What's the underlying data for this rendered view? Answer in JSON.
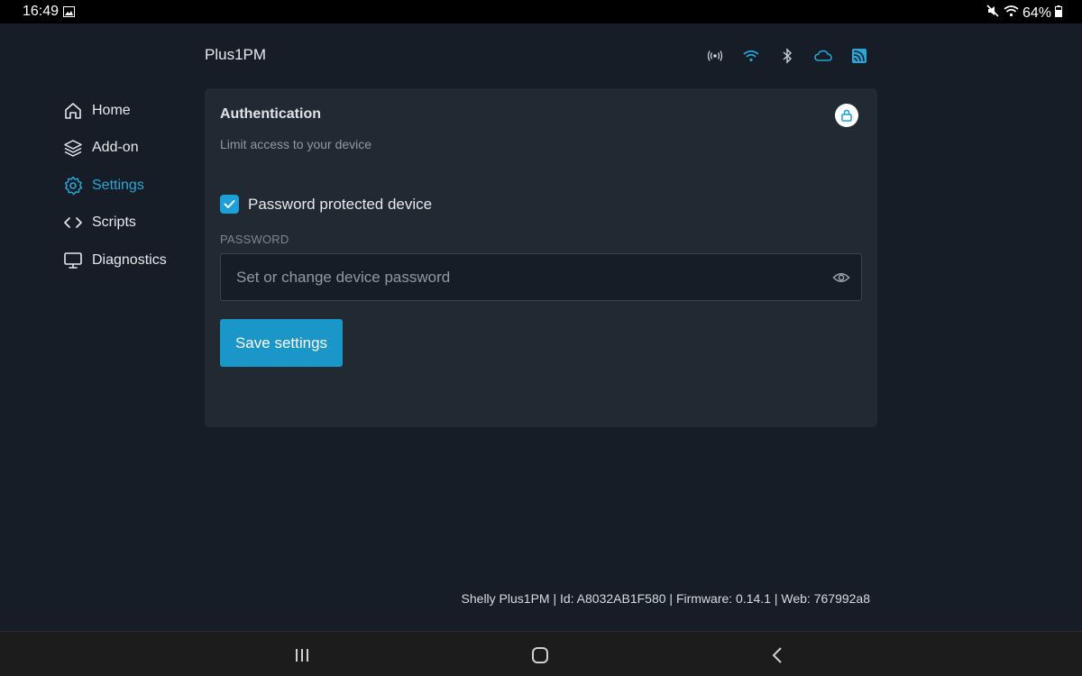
{
  "status_bar": {
    "time": "16:49",
    "battery": "64%",
    "icons": [
      "gallery-icon",
      "mute-icon",
      "wifi-icon",
      "battery-icon"
    ]
  },
  "header": {
    "device_name": "Plus1PM",
    "status_icons": [
      "ap-icon",
      "wifi-icon",
      "bluetooth-icon",
      "cloud-icon",
      "mqtt-icon"
    ],
    "accent_color": "#26a7d7"
  },
  "sidebar": {
    "items": [
      {
        "label": "Home",
        "icon": "home-icon",
        "active": false
      },
      {
        "label": "Add-on",
        "icon": "layers-icon",
        "active": false
      },
      {
        "label": "Settings",
        "icon": "gear-icon",
        "active": true
      },
      {
        "label": "Scripts",
        "icon": "code-icon",
        "active": false
      },
      {
        "label": "Diagnostics",
        "icon": "monitor-icon",
        "active": false
      }
    ]
  },
  "auth_card": {
    "title": "Authentication",
    "subtitle": "Limit access to your device",
    "checkbox_label": "Password protected device",
    "checkbox_checked": true,
    "password_label": "PASSWORD",
    "password_placeholder": "Set or change device password",
    "password_value": "",
    "save_label": "Save settings"
  },
  "footer": {
    "info": "Shelly Plus1PM | Id: A8032AB1F580 | Firmware: 0.14.1 | Web: 767992a8"
  },
  "nav_bar": {
    "buttons": [
      "recents-icon",
      "home-circle-icon",
      "back-icon"
    ]
  }
}
